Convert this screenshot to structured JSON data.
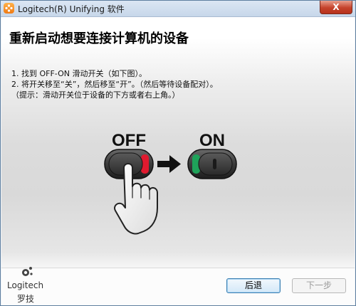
{
  "window": {
    "title": "Logitech(R) Unifying 软件",
    "close_glyph": "X"
  },
  "main": {
    "heading": "重新启动想要连接计算机的设备",
    "instructions": [
      "1. 找到 OFF-ON 滑动开关（如下图）。",
      "2. 将开关移至“关”，然后移至“开”。（然后等待设备配对）。",
      "（提示：滑动开关位于设备的下方或者右上角。）"
    ],
    "illustration": {
      "off_label": "OFF",
      "on_label": "ON",
      "off_indicator_color": "#e01a2f",
      "on_indicator_color": "#1fa35a"
    }
  },
  "footer": {
    "logo_brand": "Logitech",
    "logo_cn": "罗技",
    "back_label": "后退",
    "next_label": "下一步"
  }
}
